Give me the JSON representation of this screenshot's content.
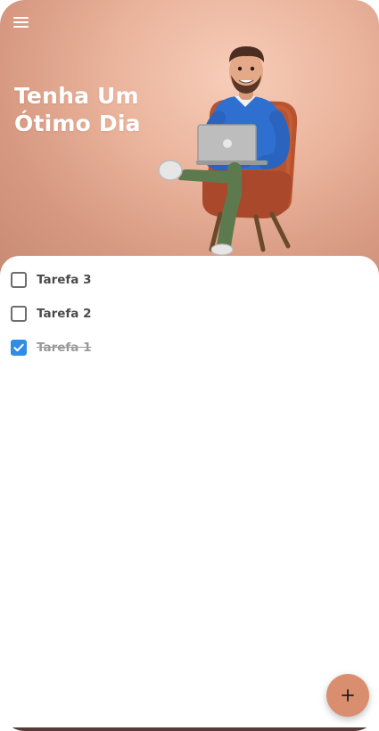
{
  "header": {
    "menu_icon": "hamburger-menu-icon",
    "greeting_line1": "Tenha Um",
    "greeting_line2": "Ótimo Dia",
    "illustration": "man-with-laptop-on-armchair",
    "background_color": "#e7b39c"
  },
  "tasks": [
    {
      "label": "Tarefa 3",
      "completed": false
    },
    {
      "label": "Tarefa 2",
      "completed": false
    },
    {
      "label": "Tarefa 1",
      "completed": true
    }
  ],
  "fab": {
    "icon": "plus-icon",
    "color": "#d98e6f"
  },
  "colors": {
    "checkbox_checked": "#2f8de4",
    "task_text": "#4a4a4a",
    "task_done_text": "#9a9a9a"
  }
}
